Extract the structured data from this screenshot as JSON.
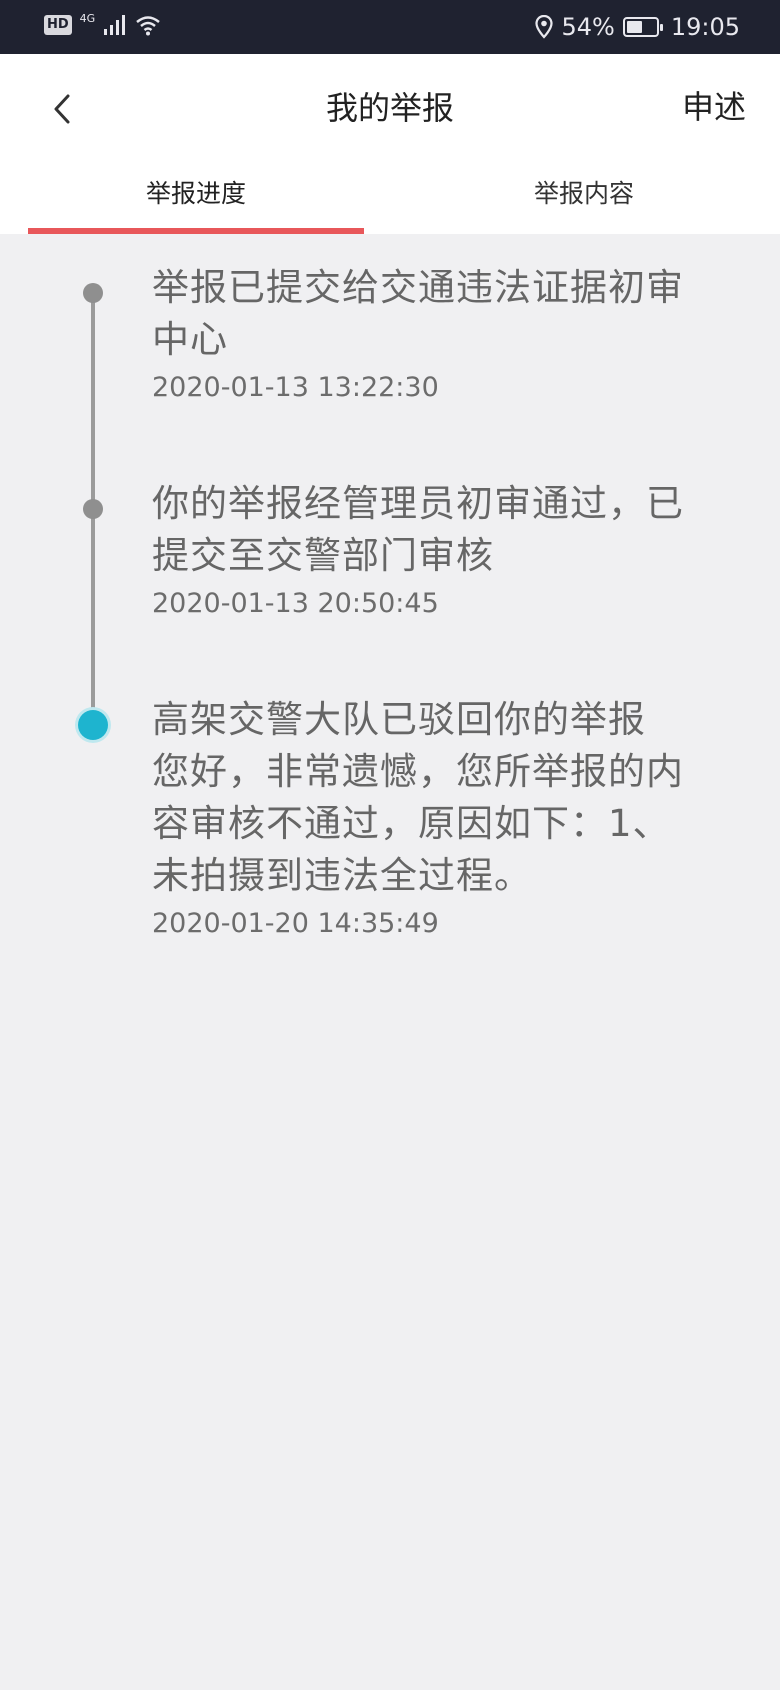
{
  "status_bar": {
    "hd": "HD",
    "network": "4G",
    "battery_percent": "54%",
    "battery_level": 0.54,
    "time": "19:05",
    "icons": [
      "signal-icon",
      "wifi-icon",
      "location-icon",
      "battery-icon"
    ]
  },
  "header": {
    "back_icon": "chevron-left-icon",
    "title": "我的举报",
    "appeal_label": "申述"
  },
  "tabs": [
    {
      "label": "举报进度",
      "active": true
    },
    {
      "label": "举报内容",
      "active": false
    }
  ],
  "timeline": [
    {
      "title": "举报已提交给交通违法证据初审中心",
      "time": "2020-01-13 13:22:30",
      "active": false
    },
    {
      "title": "你的举报经管理员初审通过，已提交至交警部门审核",
      "time": "2020-01-13 20:50:45",
      "active": false
    },
    {
      "title": "高架交警大队已驳回你的举报",
      "description": "您好，非常遗憾，您所举报的内容审核不通过，原因如下：1、未拍摄到违法全过程。",
      "time": "2020-01-20 14:35:49",
      "active": true
    }
  ],
  "colors": {
    "status_bar_bg": "#1f2230",
    "tab_indicator": "#e8575a",
    "active_dot": "#1eb4cf",
    "page_bg": "#f0f0f2"
  }
}
